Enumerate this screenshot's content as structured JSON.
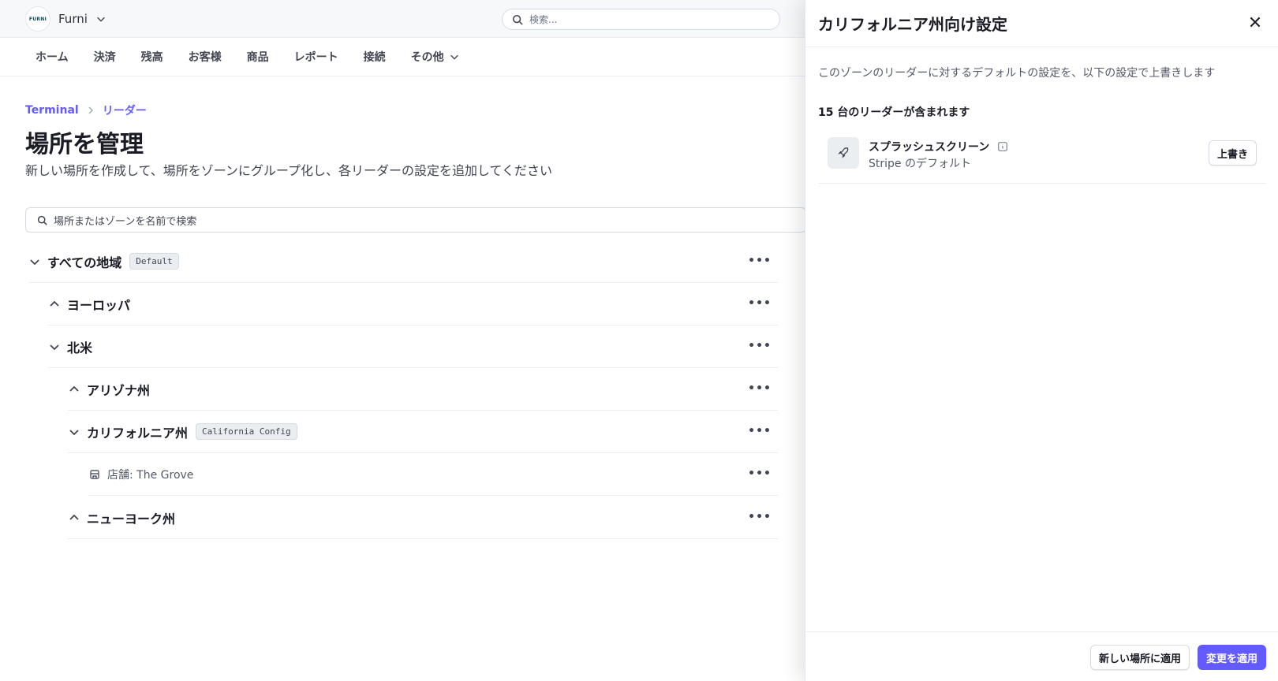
{
  "app": {
    "brand_logo_text": "FURNI",
    "account_name": "Furni"
  },
  "search": {
    "placeholder": "検索..."
  },
  "nav": {
    "items": [
      "ホーム",
      "決済",
      "残高",
      "お客様",
      "商品",
      "レポート",
      "接続"
    ],
    "more_label": "その他"
  },
  "breadcrumb": {
    "items": [
      "Terminal",
      "リーダー"
    ]
  },
  "page": {
    "title": "場所を管理",
    "subtitle": "新しい場所を作成して、場所をゾーンにグループ化し、各リーダーの設定を追加してください"
  },
  "location_search": {
    "placeholder": "場所またはゾーンを名前で検索"
  },
  "tree": [
    {
      "label": "すべての地域",
      "badge": "Default",
      "expanded": true
    },
    {
      "label": "ヨーロッパ",
      "expanded": false
    },
    {
      "label": "北米",
      "expanded": true
    },
    {
      "label": "アリゾナ州",
      "expanded": false
    },
    {
      "label": "カリフォルニア州",
      "badge": "California Config",
      "expanded": true
    },
    {
      "label": "店舗: The Grove",
      "type": "store"
    },
    {
      "label": "ニューヨーク州",
      "expanded": false
    }
  ],
  "drawer": {
    "title": "カリフォルニア州向け設定",
    "description": "このゾーンのリーダーに対するデフォルトの設定を、以下の設定で上書きします",
    "reader_count": "15 台のリーダーが含まれます",
    "setting": {
      "name": "スプラッシュスクリーン",
      "default": "Stripe のデフォルト",
      "override_label": "上書き"
    },
    "apply_new_label": "新しい場所に適用",
    "apply_label": "変更を適用"
  },
  "colors": {
    "accent": "#635bff",
    "text": "#30313d"
  }
}
